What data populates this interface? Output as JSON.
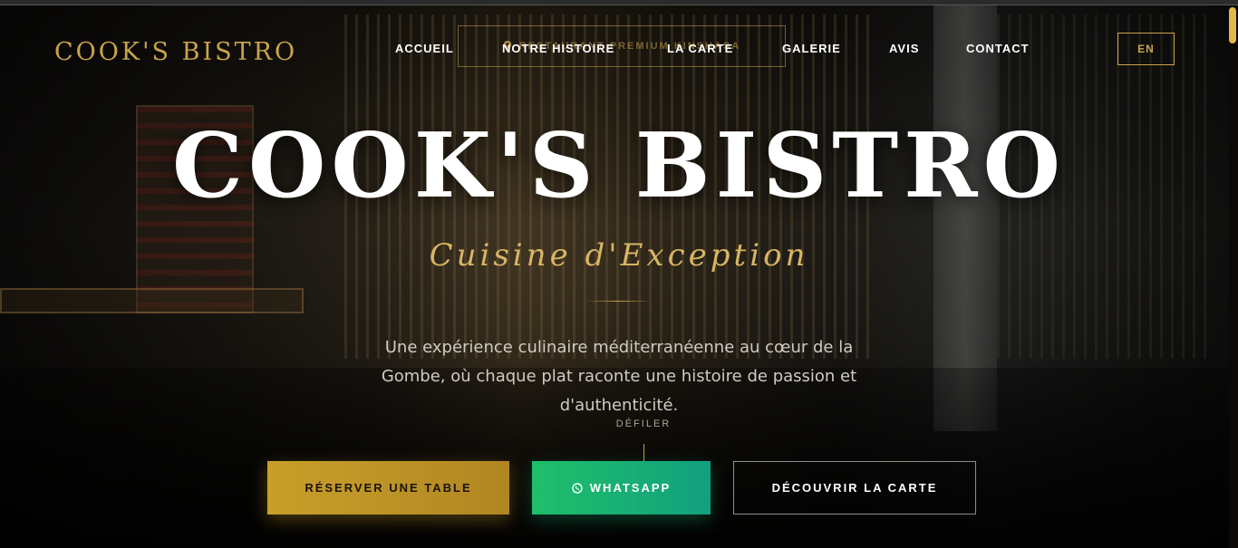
{
  "brand": {
    "logo": "COOK'S BISTRO",
    "accent_color": "#c9a34c"
  },
  "badge": {
    "icon": "location-pin-icon",
    "text": "RESTAURANT PREMIUM KINSHASA"
  },
  "nav": {
    "items": [
      {
        "label": "ACCUEIL"
      },
      {
        "label": "NOTRE HISTOIRE"
      },
      {
        "label": "LA CARTE"
      },
      {
        "label": "GALERIE"
      },
      {
        "label": "AVIS"
      },
      {
        "label": "CONTACT"
      }
    ],
    "lang": "EN"
  },
  "hero": {
    "title": "COOK'S BISTRO",
    "subtitle": "Cuisine d'Exception",
    "description": "Une expérience culinaire méditerranéenne au cœur de la Gombe, où chaque plat raconte une histoire de passion et d'authenticité.",
    "scroll_label": "DÉFILER"
  },
  "buttons": {
    "reserve": "RÉSERVER UNE TABLE",
    "whatsapp": "WHATSAPP",
    "whatsapp_icon": "whatsapp-icon",
    "menu": "DÉCOUVRIR LA CARTE"
  },
  "colors": {
    "whatsapp_green": "#1fbf6a",
    "gold_button": "#c99f2a"
  }
}
